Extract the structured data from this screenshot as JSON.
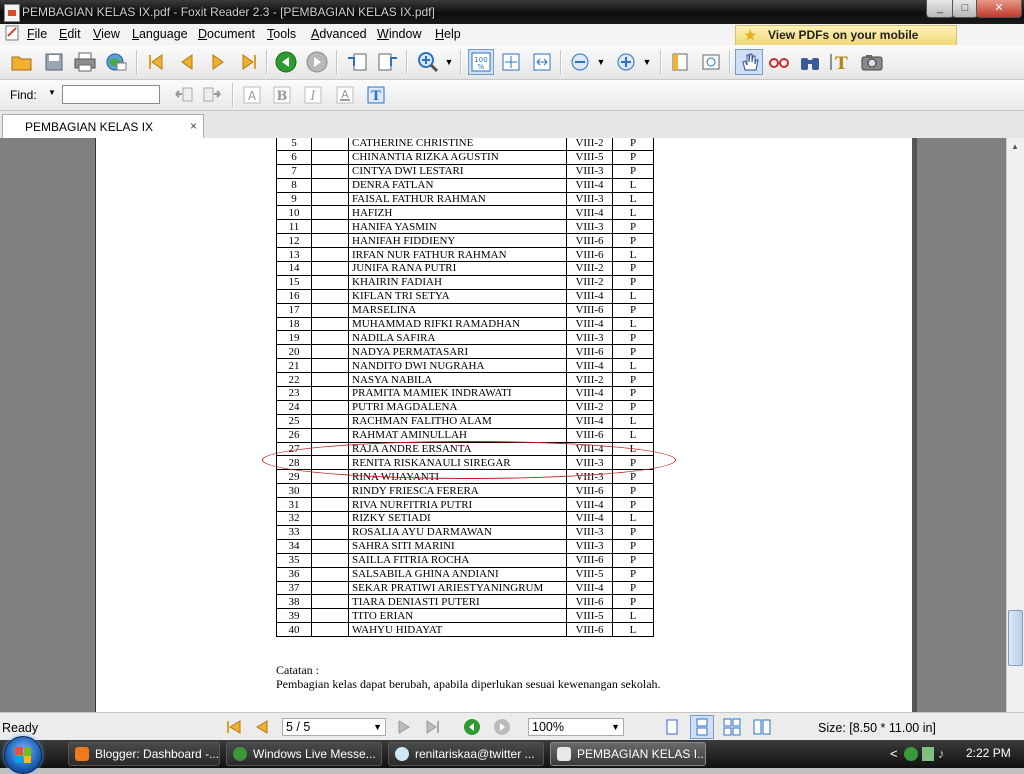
{
  "window": {
    "title": "PEMBAGIAN KELAS IX.pdf - Foxit Reader 2.3 - [PEMBAGIAN KELAS IX.pdf]",
    "controls": [
      "_",
      "□",
      "✕"
    ]
  },
  "menu": {
    "items": [
      {
        "key": "F",
        "rest": "ile"
      },
      {
        "key": "E",
        "rest": "dit"
      },
      {
        "key": "V",
        "rest": "iew"
      },
      {
        "key": "L",
        "rest": "anguage"
      },
      {
        "key": "D",
        "rest": "ocument"
      },
      {
        "key": "T",
        "rest": "ools"
      },
      {
        "key": "A",
        "rest": "dvanced"
      },
      {
        "key": "W",
        "rest": "indow"
      },
      {
        "key": "H",
        "rest": "elp"
      }
    ],
    "promo": "View PDFs on your mobile devices"
  },
  "find": {
    "label": "Find:",
    "value": ""
  },
  "tab": {
    "label": "PEMBAGIAN KELAS IX",
    "close": "×"
  },
  "document": {
    "rows": [
      {
        "no": "5",
        "name": "CATHERINE CHRISTINE",
        "cls": "VIII-2",
        "sex": "P"
      },
      {
        "no": "6",
        "name": "CHINANTIA RIZKA AGUSTIN",
        "cls": "VIII-5",
        "sex": "P"
      },
      {
        "no": "7",
        "name": "CINTYA DWI LESTARI",
        "cls": "VIII-3",
        "sex": "P"
      },
      {
        "no": "8",
        "name": "DENRA FATLAN",
        "cls": "VIII-4",
        "sex": "L"
      },
      {
        "no": "9",
        "name": "FAISAL FATHUR RAHMAN",
        "cls": "VIII-3",
        "sex": "L"
      },
      {
        "no": "10",
        "name": "HAFIZH",
        "cls": "VIII-4",
        "sex": "L"
      },
      {
        "no": "11",
        "name": "HANIFA YASMIN",
        "cls": "VIII-3",
        "sex": "P"
      },
      {
        "no": "12",
        "name": "HANIFAH FIDDIENY",
        "cls": "VIII-6",
        "sex": "P"
      },
      {
        "no": "13",
        "name": "IRFAN NUR FATHUR RAHMAN",
        "cls": "VIII-6",
        "sex": "L"
      },
      {
        "no": "14",
        "name": "JUNIFA RANA PUTRI",
        "cls": "VIII-2",
        "sex": "P"
      },
      {
        "no": "15",
        "name": "KHAIRIN FADIAH",
        "cls": "VIII-2",
        "sex": "P"
      },
      {
        "no": "16",
        "name": "KIFLAN TRI SETYA",
        "cls": "VIII-4",
        "sex": "L"
      },
      {
        "no": "17",
        "name": "MARSELINA",
        "cls": "VIII-6",
        "sex": "P"
      },
      {
        "no": "18",
        "name": "MUHAMMAD RIFKI RAMADHAN",
        "cls": "VIII-4",
        "sex": "L"
      },
      {
        "no": "19",
        "name": "NADILA SAFIRA",
        "cls": "VIII-3",
        "sex": "P"
      },
      {
        "no": "20",
        "name": "NADYA PERMATASARI",
        "cls": "VIII-6",
        "sex": "P"
      },
      {
        "no": "21",
        "name": "NANDITO DWI NUGRAHA",
        "cls": "VIII-4",
        "sex": "L"
      },
      {
        "no": "22",
        "name": "NASYA NABILA",
        "cls": "VIII-2",
        "sex": "P"
      },
      {
        "no": "23",
        "name": "PRAMITA MAMIEK INDRAWATI",
        "cls": "VIII-4",
        "sex": "P"
      },
      {
        "no": "24",
        "name": "PUTRI MAGDALENA",
        "cls": "VIII-2",
        "sex": "P"
      },
      {
        "no": "25",
        "name": "RACHMAN FALITHO ALAM",
        "cls": "VIII-4",
        "sex": "L"
      },
      {
        "no": "26",
        "name": "RAHMAT AMINULLAH",
        "cls": "VIII-6",
        "sex": "L"
      },
      {
        "no": "27",
        "name": "RAJA ANDRE ERSANTA",
        "cls": "VIII-4",
        "sex": "L"
      },
      {
        "no": "28",
        "name": "RENITA RISKANAULI SIREGAR",
        "cls": "VIII-3",
        "sex": "P"
      },
      {
        "no": "29",
        "name": "RINA WIJAYANTI",
        "cls": "VIII-3",
        "sex": "P"
      },
      {
        "no": "30",
        "name": "RINDY FRIESCA FERERA",
        "cls": "VIII-6",
        "sex": "P"
      },
      {
        "no": "31",
        "name": "RIVA NURFITRIA PUTRI",
        "cls": "VIII-4",
        "sex": "P"
      },
      {
        "no": "32",
        "name": "RIZKY SETIADI",
        "cls": "VIII-4",
        "sex": "L"
      },
      {
        "no": "33",
        "name": "ROSALIA AYU DARMAWAN",
        "cls": "VIII-3",
        "sex": "P"
      },
      {
        "no": "34",
        "name": "SAHRA SITI MARINI",
        "cls": "VIII-3",
        "sex": "P"
      },
      {
        "no": "35",
        "name": "SAILLA FITRIA ROCHA",
        "cls": "VIII-6",
        "sex": "P"
      },
      {
        "no": "36",
        "name": "SALSABILA GHINA ANDIANI",
        "cls": "VIII-5",
        "sex": "P"
      },
      {
        "no": "37",
        "name": "SEKAR PRATIWI ARIESTYANINGRUM",
        "cls": "VIII-4",
        "sex": "P"
      },
      {
        "no": "38",
        "name": "TIARA DENIASTI PUTERI",
        "cls": "VIII-6",
        "sex": "P"
      },
      {
        "no": "39",
        "name": "TITO ERIAN",
        "cls": "VIII-5",
        "sex": "L"
      },
      {
        "no": "40",
        "name": "WAHYU HIDAYAT",
        "cls": "VIII-6",
        "sex": "L"
      }
    ],
    "highlighted_no": "28",
    "note_title": "Catatan :",
    "note_body": "Pembagian kelas dapat berubah, apabila diperlukan sesuai kewenangan sekolah."
  },
  "status": {
    "ready": "Ready",
    "page": "5 / 5",
    "zoom": "100%",
    "size": "Size: [8.50 * 11.00 in]"
  },
  "taskbar": {
    "tasks": [
      {
        "label": "Blogger: Dashboard -...",
        "color": "#f07a1a"
      },
      {
        "label": "Windows Live Messe...",
        "color": "#3a9a3a"
      },
      {
        "label": "renitariskaa@twitter ...",
        "color": "#cfe8f6"
      },
      {
        "label": "PEMBAGIAN KELAS I...",
        "color": "#e8e8e8"
      }
    ],
    "tray_arrow": "<",
    "clock": "2:22 PM"
  },
  "colors": {
    "accent_folder": "#f0b030",
    "nav_green": "#2f9a2f",
    "nav_blue": "#2a6fc9",
    "highlight_ellipse": "#c02020"
  }
}
